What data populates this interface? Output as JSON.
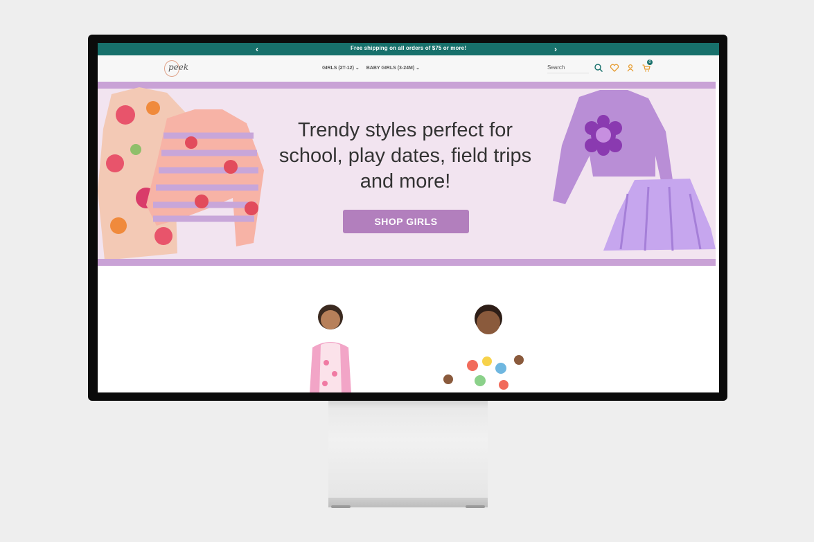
{
  "announcement": {
    "message": "Free shipping on all orders of $75 or more!",
    "prev_icon": "chevron-left-icon",
    "next_icon": "chevron-right-icon"
  },
  "header": {
    "logo_text": "peek",
    "nav": [
      "GIRLS (2T-12) ⌄",
      "BABY GIRLS (3-24M) ⌄"
    ],
    "search_placeholder": "Search",
    "icons": [
      "search-icon",
      "heart-icon",
      "user-icon",
      "cart-icon"
    ],
    "cart_count": "0"
  },
  "hero": {
    "headline_line1": "Trendy styles perfect for",
    "headline_line2": "school, play dates, field trips",
    "headline_line3": "and more!",
    "button_label": "SHOP GIRLS"
  },
  "colors": {
    "accent": "#17706b",
    "hero_bg": "#f2e4f0",
    "band": "#c9a2d6",
    "button": "#b27fbd"
  }
}
